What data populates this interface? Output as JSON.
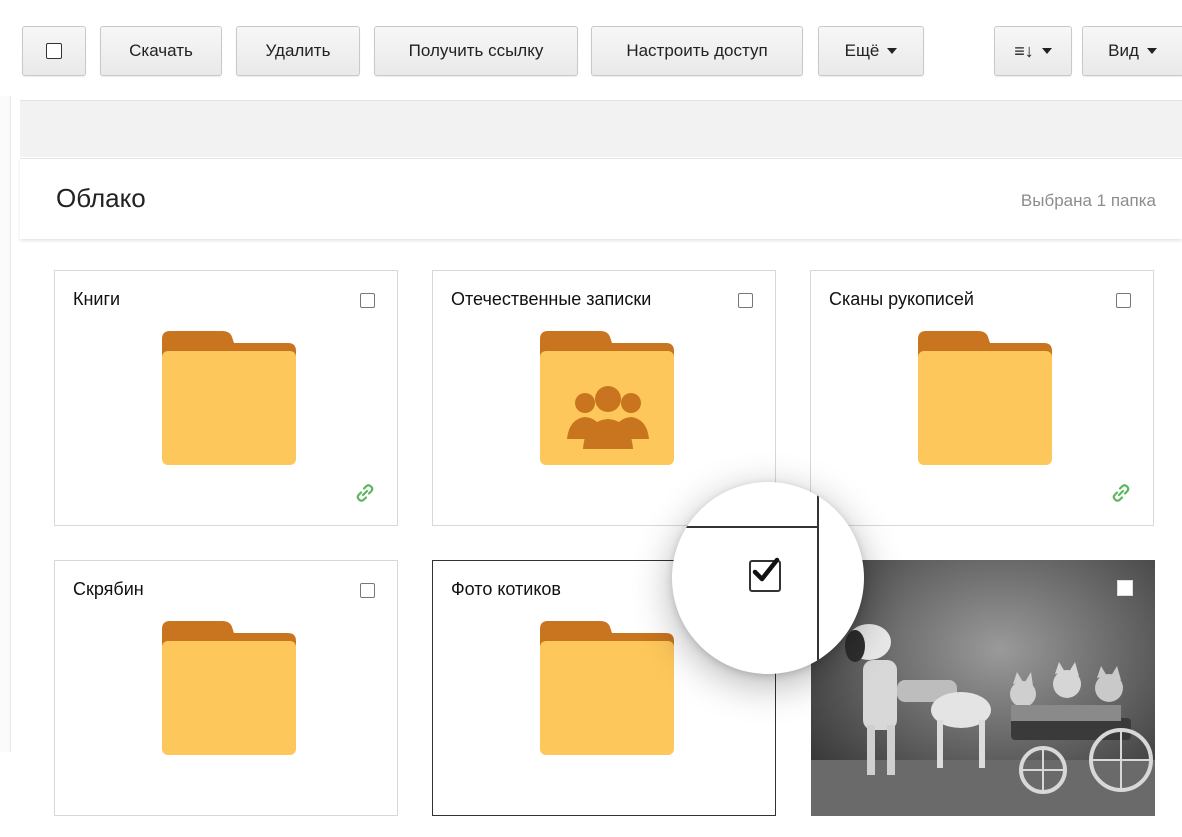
{
  "toolbar": {
    "download_label": "Скачать",
    "delete_label": "Удалить",
    "get_link_label": "Получить ссылку",
    "access_label": "Настроить доступ",
    "more_label": "Ещё",
    "sort_glyph": "≡↓",
    "view_label": "Вид"
  },
  "header": {
    "title": "Облако",
    "selection_status": "Выбрана 1 папка"
  },
  "items": [
    {
      "name": "Книги",
      "type": "folder",
      "shared_link": true,
      "shared_users": false,
      "checked": false
    },
    {
      "name": "Отечественные записки",
      "type": "folder",
      "shared_link": false,
      "shared_users": true,
      "checked": false
    },
    {
      "name": "Сканы рукописей",
      "type": "folder",
      "shared_link": true,
      "shared_users": false,
      "checked": false
    },
    {
      "name": "Скрябин",
      "type": "folder",
      "shared_link": false,
      "shared_users": false,
      "checked": false
    },
    {
      "name": "Фото котиков",
      "type": "folder",
      "shared_link": false,
      "shared_users": false,
      "checked": true
    },
    {
      "name": "",
      "type": "photo",
      "checked": false
    }
  ],
  "colors": {
    "folder_body": "#fdc75b",
    "folder_tab": "#c9741f",
    "link_green": "#5cb85c",
    "status_gray": "#8c8c8c"
  },
  "icons": [
    "checkbox-icon",
    "caret-down-icon",
    "sort-icon",
    "folder-icon",
    "shared-users-icon",
    "link-icon",
    "checkmark-icon"
  ]
}
